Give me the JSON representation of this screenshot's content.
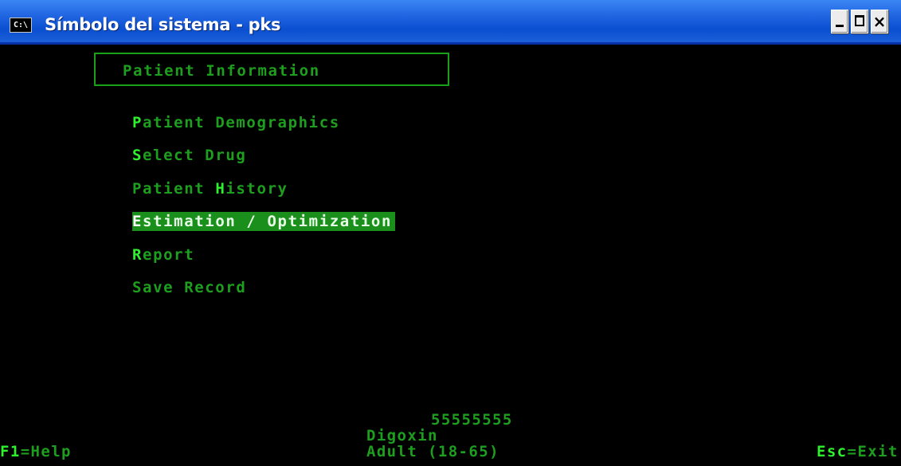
{
  "window": {
    "title": "Símbolo del sistema - pks",
    "icon": "cmd-icon",
    "icon_text": "C:\\",
    "buttons": {
      "minimize": "_",
      "maximize": "□",
      "close": "×"
    }
  },
  "panel": {
    "title": "Patient Information"
  },
  "menu": {
    "items": [
      {
        "hotkey": "P",
        "rest": "atient Demographics"
      },
      {
        "hotkey": "S",
        "rest": "elect Drug"
      },
      {
        "prefix": "Patient ",
        "hotkey": "H",
        "rest": "istory"
      },
      {
        "hotkey": "E",
        "rest": "stimation / Optimization",
        "selected": true
      },
      {
        "hotkey": "R",
        "rest": "eport"
      },
      {
        "hotkey": "",
        "rest": "Save Record"
      }
    ]
  },
  "status": {
    "patient_id": "55555555",
    "drug": "Digoxin",
    "group": "Adult (18-65)",
    "help_key": "F1",
    "help_label": "=Help",
    "exit_key": "Esc",
    "exit_label": "=Exit"
  },
  "colors": {
    "background": "#000000",
    "text_green": "#1e9e1e",
    "hotkey_green": "#2ff02f",
    "highlight": "#1b8f1b",
    "titlebar_blue": "#0a4fd0"
  }
}
